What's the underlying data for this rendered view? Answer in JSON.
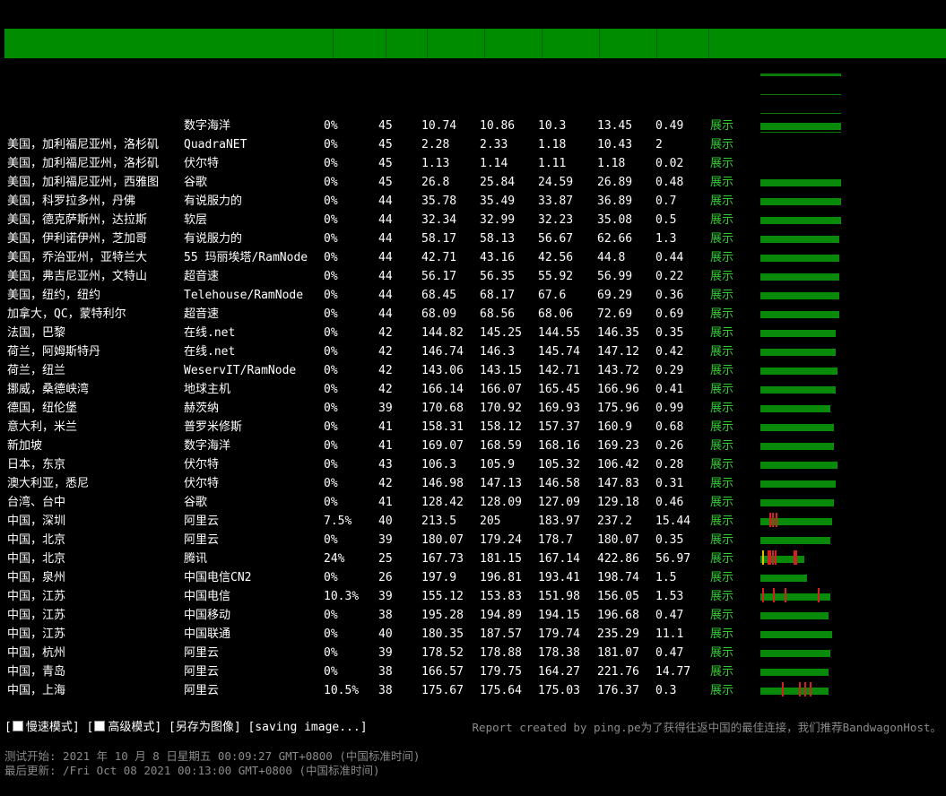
{
  "rows": [
    {
      "location": "",
      "provider": "数字海洋",
      "loss": "0%",
      "sent": "45",
      "last": "10.74",
      "avg": "10.86",
      "best": "10.3",
      "worst": "13.45",
      "stdev": "0.49",
      "action": "展示",
      "bar": 0.95,
      "spikes": []
    },
    {
      "location": "美国，加利福尼亚州，洛杉矶",
      "provider": "QuadraNET",
      "loss": "0%",
      "sent": "45",
      "last": "2.28",
      "avg": "2.33",
      "best": "1.18",
      "worst": "10.43",
      "stdev": "2",
      "action": "展示",
      "bar": 0,
      "spikes": []
    },
    {
      "location": "美国，加利福尼亚州，洛杉矶",
      "provider": "伏尔特",
      "loss": "0%",
      "sent": "45",
      "last": "1.13",
      "avg": "1.14",
      "best": "1.11",
      "worst": "1.18",
      "stdev": "0.02",
      "action": "展示",
      "bar": 0,
      "spikes": []
    },
    {
      "location": "美国，加利福尼亚州，西雅图",
      "provider": "谷歌",
      "loss": "0%",
      "sent": "45",
      "last": "26.8",
      "avg": "25.84",
      "best": "24.59",
      "worst": "26.89",
      "stdev": "0.48",
      "action": "展示",
      "bar": 0.95,
      "spikes": []
    },
    {
      "location": "美国，科罗拉多州，丹佛",
      "provider": "有说服力的",
      "loss": "0%",
      "sent": "44",
      "last": "35.78",
      "avg": "35.49",
      "best": "33.87",
      "worst": "36.89",
      "stdev": "0.7",
      "action": "展示",
      "bar": 0.95,
      "spikes": []
    },
    {
      "location": "美国，德克萨斯州，达拉斯",
      "provider": "软层",
      "loss": "0%",
      "sent": "44",
      "last": "32.34",
      "avg": "32.99",
      "best": "32.23",
      "worst": "35.08",
      "stdev": "0.5",
      "action": "展示",
      "bar": 0.95,
      "spikes": []
    },
    {
      "location": "美国，伊利诺伊州，芝加哥",
      "provider": "有说服力的",
      "loss": "0%",
      "sent": "44",
      "last": "58.17",
      "avg": "58.13",
      "best": "56.67",
      "worst": "62.66",
      "stdev": "1.3",
      "action": "展示",
      "bar": 0.93,
      "spikes": []
    },
    {
      "location": "美国，乔治亚州，亚特兰大",
      "provider": "55 玛丽埃塔/RamNode",
      "loss": "0%",
      "sent": "44",
      "last": "42.71",
      "avg": "43.16",
      "best": "42.56",
      "worst": "44.8",
      "stdev": "0.44",
      "action": "展示",
      "bar": 0.93,
      "spikes": []
    },
    {
      "location": "美国，弗吉尼亚州，文特山",
      "provider": "超音速",
      "loss": "0%",
      "sent": "44",
      "last": "56.17",
      "avg": "56.35",
      "best": "55.92",
      "worst": "56.99",
      "stdev": "0.22",
      "action": "展示",
      "bar": 0.93,
      "spikes": []
    },
    {
      "location": "美国，纽约，纽约",
      "provider": "Telehouse/RamNode",
      "loss": "0%",
      "sent": "44",
      "last": "68.45",
      "avg": "68.17",
      "best": "67.6",
      "worst": "69.29",
      "stdev": "0.36",
      "action": "展示",
      "bar": 0.93,
      "spikes": []
    },
    {
      "location": "加拿大，QC，蒙特利尔",
      "provider": "超音速",
      "loss": "0%",
      "sent": "44",
      "last": "68.09",
      "avg": "68.56",
      "best": "68.06",
      "worst": "72.69",
      "stdev": "0.69",
      "action": "展示",
      "bar": 0.93,
      "spikes": []
    },
    {
      "location": "法国，巴黎",
      "provider": "在线.net",
      "loss": "0%",
      "sent": "42",
      "last": "144.82",
      "avg": "145.25",
      "best": "144.55",
      "worst": "146.35",
      "stdev": "0.35",
      "action": "展示",
      "bar": 0.88,
      "spikes": []
    },
    {
      "location": "荷兰，阿姆斯特丹",
      "provider": "在线.net",
      "loss": "0%",
      "sent": "42",
      "last": "146.74",
      "avg": "146.3",
      "best": "145.74",
      "worst": "147.12",
      "stdev": "0.42",
      "action": "展示",
      "bar": 0.88,
      "spikes": []
    },
    {
      "location": "荷兰，纽兰",
      "provider": "WeservIT/RamNode",
      "loss": "0%",
      "sent": "42",
      "last": "143.06",
      "avg": "143.15",
      "best": "142.71",
      "worst": "143.72",
      "stdev": "0.29",
      "action": "展示",
      "bar": 0.9,
      "spikes": []
    },
    {
      "location": "挪威，桑德峡湾",
      "provider": "地球主机",
      "loss": "0%",
      "sent": "42",
      "last": "166.14",
      "avg": "166.07",
      "best": "165.45",
      "worst": "166.96",
      "stdev": "0.41",
      "action": "展示",
      "bar": 0.88,
      "spikes": []
    },
    {
      "location": "德国，纽伦堡",
      "provider": "赫茨纳",
      "loss": "0%",
      "sent": "39",
      "last": "170.68",
      "avg": "170.92",
      "best": "169.93",
      "worst": "175.96",
      "stdev": "0.99",
      "action": "展示",
      "bar": 0.82,
      "spikes": []
    },
    {
      "location": "意大利，米兰",
      "provider": "普罗米修斯",
      "loss": "0%",
      "sent": "41",
      "last": "158.31",
      "avg": "158.12",
      "best": "157.37",
      "worst": "160.9",
      "stdev": "0.68",
      "action": "展示",
      "bar": 0.86,
      "spikes": []
    },
    {
      "location": "新加坡",
      "provider": "数字海洋",
      "loss": "0%",
      "sent": "41",
      "last": "169.07",
      "avg": "168.59",
      "best": "168.16",
      "worst": "169.23",
      "stdev": "0.26",
      "action": "展示",
      "bar": 0.86,
      "spikes": []
    },
    {
      "location": "日本，东京",
      "provider": "伏尔特",
      "loss": "0%",
      "sent": "43",
      "last": "106.3",
      "avg": "105.9",
      "best": "105.32",
      "worst": "106.42",
      "stdev": "0.28",
      "action": "展示",
      "bar": 0.9,
      "spikes": []
    },
    {
      "location": "澳大利亚，悉尼",
      "provider": "伏尔特",
      "loss": "0%",
      "sent": "42",
      "last": "146.98",
      "avg": "147.13",
      "best": "146.58",
      "worst": "147.83",
      "stdev": "0.31",
      "action": "展示",
      "bar": 0.88,
      "spikes": []
    },
    {
      "location": "台湾、台中",
      "provider": "谷歌",
      "loss": "0%",
      "sent": "41",
      "last": "128.42",
      "avg": "128.09",
      "best": "127.09",
      "worst": "129.18",
      "stdev": "0.46",
      "action": "展示",
      "bar": 0.86,
      "spikes": []
    },
    {
      "location": "中国，深圳",
      "provider": "阿里云",
      "loss": "7.5%",
      "sent": "40",
      "last": "213.5",
      "avg": "205",
      "best": "183.97",
      "worst": "237.2",
      "stdev": "15.44",
      "action": "展示",
      "bar": 0.84,
      "spikes": [
        0.1,
        0.14,
        0.18
      ]
    },
    {
      "location": "中国，北京",
      "provider": "阿里云",
      "loss": "0%",
      "sent": "39",
      "last": "180.07",
      "avg": "179.24",
      "best": "178.7",
      "worst": "180.07",
      "stdev": "0.35",
      "action": "展示",
      "bar": 0.82,
      "spikes": []
    },
    {
      "location": "中国，北京",
      "provider": "腾讯",
      "loss": "24%",
      "sent": "25",
      "last": "167.73",
      "avg": "181.15",
      "best": "167.14",
      "worst": "422.86",
      "stdev": "56.97",
      "action": "展示",
      "bar": 0.52,
      "spikes": [
        0.02,
        0.08,
        0.11,
        0.14,
        0.17,
        0.39,
        0.41
      ]
    },
    {
      "location": "中国，泉州",
      "provider": "中国电信CN2",
      "loss": "0%",
      "sent": "26",
      "last": "197.9",
      "avg": "196.81",
      "best": "193.41",
      "worst": "198.74",
      "stdev": "1.5",
      "action": "展示",
      "bar": 0.55,
      "spikes": []
    },
    {
      "location": "中国，江苏",
      "provider": "中国电信",
      "loss": "10.3%",
      "sent": "39",
      "last": "155.12",
      "avg": "153.83",
      "best": "151.98",
      "worst": "156.05",
      "stdev": "1.53",
      "action": "展示",
      "bar": 0.82,
      "spikes": [
        0.02,
        0.15,
        0.28,
        0.67
      ]
    },
    {
      "location": "中国，江苏",
      "provider": "中国移动",
      "loss": "0%",
      "sent": "38",
      "last": "195.28",
      "avg": "194.89",
      "best": "194.15",
      "worst": "196.68",
      "stdev": "0.47",
      "action": "展示",
      "bar": 0.8,
      "spikes": []
    },
    {
      "location": "中国，江苏",
      "provider": "中国联通",
      "loss": "0%",
      "sent": "40",
      "last": "180.35",
      "avg": "187.57",
      "best": "179.74",
      "worst": "235.29",
      "stdev": "11.1",
      "action": "展示",
      "bar": 0.84,
      "spikes": []
    },
    {
      "location": "中国，杭州",
      "provider": "阿里云",
      "loss": "0%",
      "sent": "39",
      "last": "178.52",
      "avg": "178.88",
      "best": "178.38",
      "worst": "181.07",
      "stdev": "0.47",
      "action": "展示",
      "bar": 0.82,
      "spikes": []
    },
    {
      "location": "中国，青岛",
      "provider": "阿里云",
      "loss": "0%",
      "sent": "38",
      "last": "166.57",
      "avg": "179.75",
      "best": "164.27",
      "worst": "221.76",
      "stdev": "14.77",
      "action": "展示",
      "bar": 0.8,
      "spikes": []
    },
    {
      "location": "中国，上海",
      "provider": "阿里云",
      "loss": "10.5%",
      "sent": "38",
      "last": "175.67",
      "avg": "175.64",
      "best": "175.03",
      "worst": "176.37",
      "stdev": "0.3",
      "action": "展示",
      "bar": 0.8,
      "spikes": [
        0.25,
        0.45,
        0.52,
        0.58
      ]
    }
  ],
  "controls": {
    "open_bracket": "[",
    "slow_mode": "慢速模式",
    "sep": "] [",
    "advanced_mode": "高级模式",
    "save_image": "] [另存为图像]",
    "saving": " [saving image...]"
  },
  "report": "Report created by ping.pe为了获得往返中国的最佳连接，我们推荐BandwagonHost。",
  "meta": {
    "test_start": "测试开始: 2021 年 10 月 8 日星期五 00:09:27 GMT+0800 (中国标准时间)",
    "last_update": "最后更新: /Fri Oct 08 2021 00:13:00 GMT+0800 (中国标准时间)"
  },
  "colors": {
    "header": "#008c00",
    "bar": "#0a8a0a",
    "loss_spike": "#d42020",
    "link": "#33cc33"
  }
}
